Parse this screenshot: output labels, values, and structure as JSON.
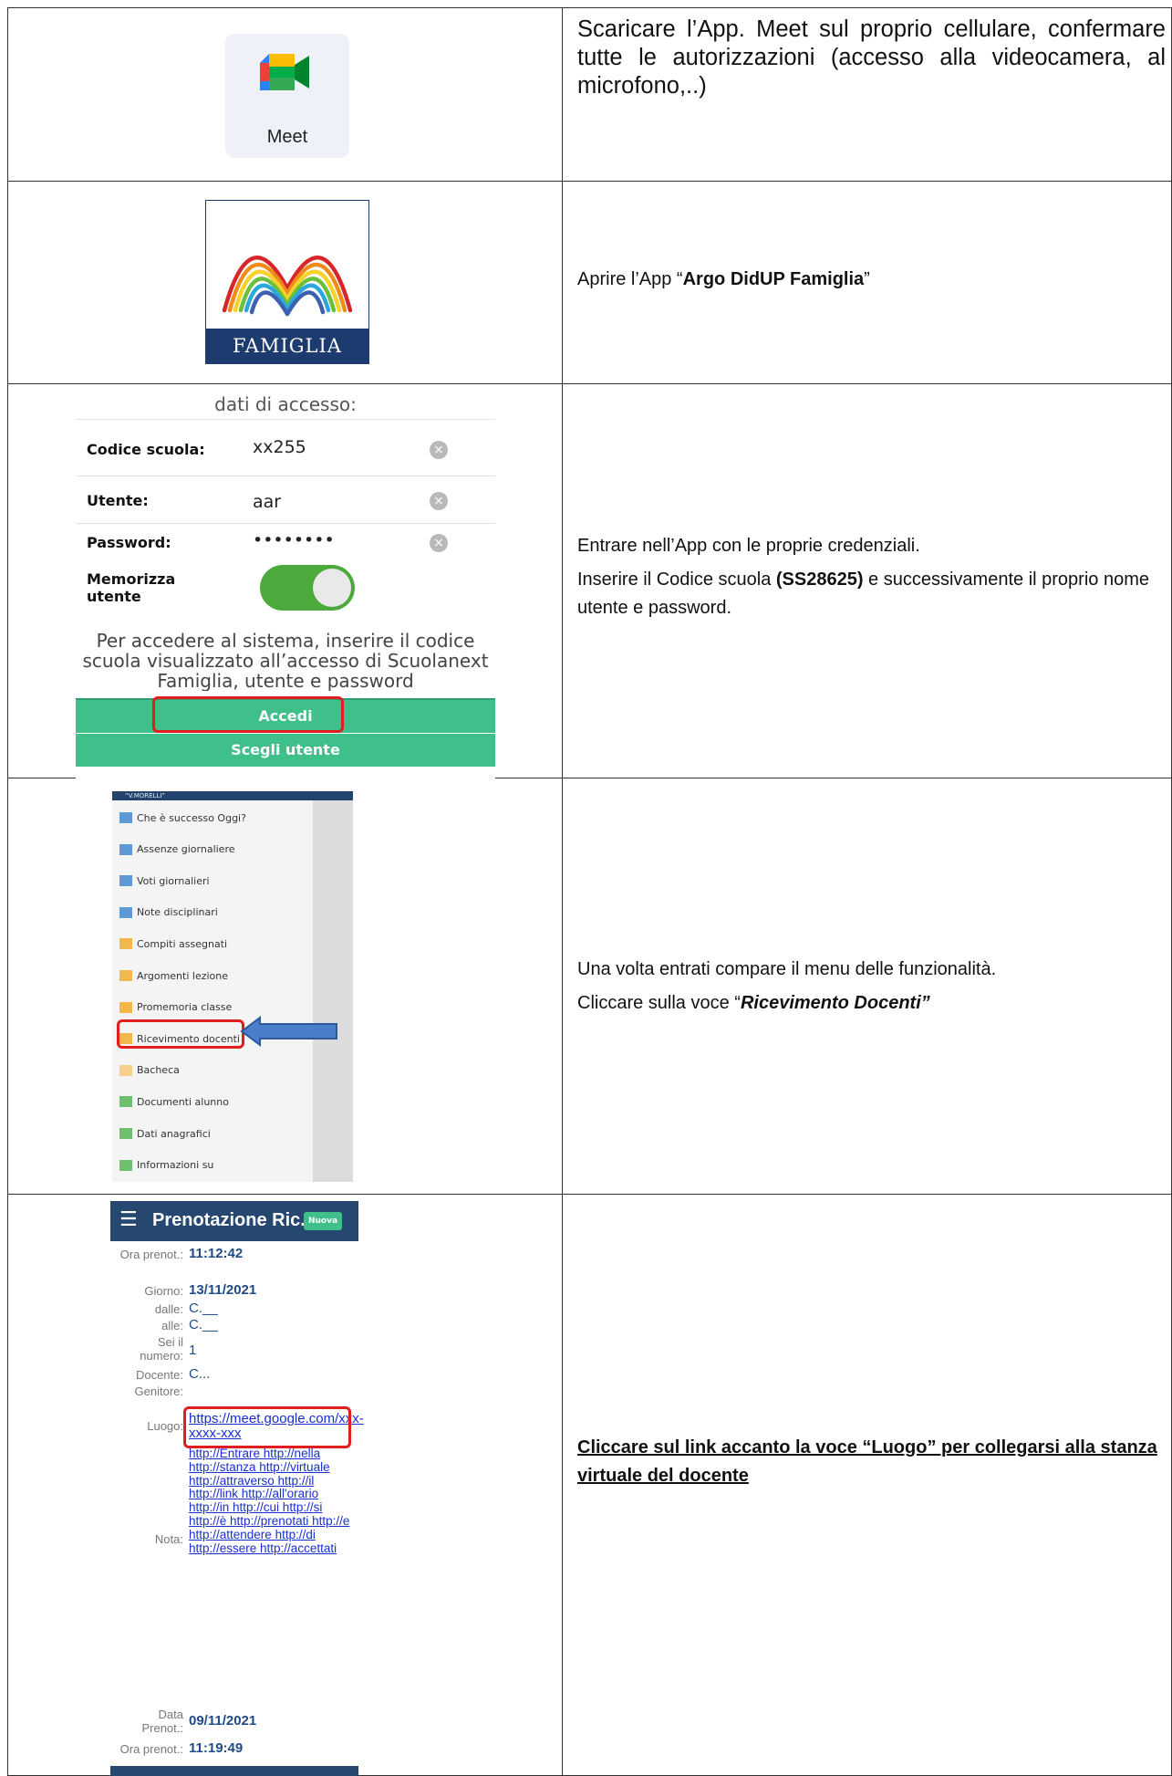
{
  "rows": [
    {
      "image": {
        "app_label": "Meet",
        "icon": "google-meet-icon"
      },
      "text": "Scaricare l’App. Meet sul proprio cellulare, confermare tutte le autorizzazioni (accesso alla videocamera, al microfono,..)"
    },
    {
      "image": {
        "logo_text": "FAMIGLIA",
        "icon": "argo-famiglia-logo"
      },
      "text_before": "Aprire l’App “",
      "text_bold": "Argo DidUP Famiglia",
      "text_after": "”"
    },
    {
      "image": {
        "header": "dati di accesso:",
        "fields": [
          {
            "label": "Codice scuola:",
            "value": "xx255"
          },
          {
            "label": "Utente:",
            "value": "aar"
          },
          {
            "label": "Password:",
            "value": "••••••••"
          }
        ],
        "remember_label_1": "Memorizza",
        "remember_label_2": "utente",
        "remember_on": true,
        "help_text": "Per accedere al sistema, inserire il codice scuola visualizzato all’accesso di Scuolanext Famiglia, utente e password",
        "login_button": "Accedi",
        "choose_user_button": "Scegli utente"
      },
      "text_line1": "Entrare nell’App con le proprie credenziali.",
      "text_line2_before": "Inserire il Codice scuola ",
      "text_line2_bold": "(SS28625)",
      "text_line2_after": " e successivamente il proprio nome utente e password."
    },
    {
      "image": {
        "menu_header": "“V.MORELLI”",
        "items": [
          {
            "label": "Che è successo Oggi?",
            "color": "#5b9bd5"
          },
          {
            "label": "Assenze giornaliere",
            "color": "#5b9bd5"
          },
          {
            "label": "Voti giornalieri",
            "color": "#5b9bd5"
          },
          {
            "label": "Note disciplinari",
            "color": "#5b9bd5"
          },
          {
            "label": "Compiti assegnati",
            "color": "#f2b84b"
          },
          {
            "label": "Argomenti lezione",
            "color": "#f2b84b"
          },
          {
            "label": "Promemoria classe",
            "color": "#f2b84b"
          },
          {
            "label": "Ricevimento docenti",
            "color": "#f2b84b"
          },
          {
            "label": "Bacheca",
            "color": "#f6d08a"
          },
          {
            "label": "Documenti alunno",
            "color": "#6cbf6c"
          },
          {
            "label": "Dati anagrafici",
            "color": "#6cbf6c"
          },
          {
            "label": "Informazioni su",
            "color": "#6cbf6c"
          }
        ]
      },
      "text_line1": "Una volta entrati compare il menu delle funzionalità.",
      "text_line2_before": "Cliccare sulla voce “",
      "text_line2_bold": "Ricevimento Docenti”"
    },
    {
      "image": {
        "title": "Prenotazione Ric...",
        "new_button": "Nuova",
        "ora_prenot_label": "Ora prenot.:",
        "ora_prenot_value": "11:12:42",
        "giorno_label": "Giorno:",
        "giorno_value": "13/11/2021",
        "dalle_label": "dalle:",
        "dalle_value": "C.__",
        "alle_label": "alle:",
        "alle_value": "C.__",
        "sei_il_label_1": "Sei il",
        "sei_il_label_2": "numero:",
        "sei_il_value": "1",
        "docente_label": "Docente:",
        "docente_value": "C...",
        "genitore_label": "Genitore:",
        "luogo_label": "Luogo:",
        "luogo_link": "https://meet.google.com/xxx-xxxx-xxx",
        "nota_label": "Nota:",
        "nota_links": "http://Entrare http://nella http://stanza http://virtuale http://attraverso http://il http://link http://all'orario http://in http://cui http://si http://è http://prenotati http://e http://attendere http://di http://essere http://accettati",
        "data_prenot_label_1": "Data",
        "data_prenot_label_2": "Prenot.:",
        "data_prenot_value": "09/11/2021",
        "ora_prenot2_label": "Ora prenot.:",
        "ora_prenot2_value": "11:19:49"
      },
      "text": "Cliccare sul link accanto la voce “Luogo” per collegarsi alla stanza virtuale del docente"
    }
  ]
}
